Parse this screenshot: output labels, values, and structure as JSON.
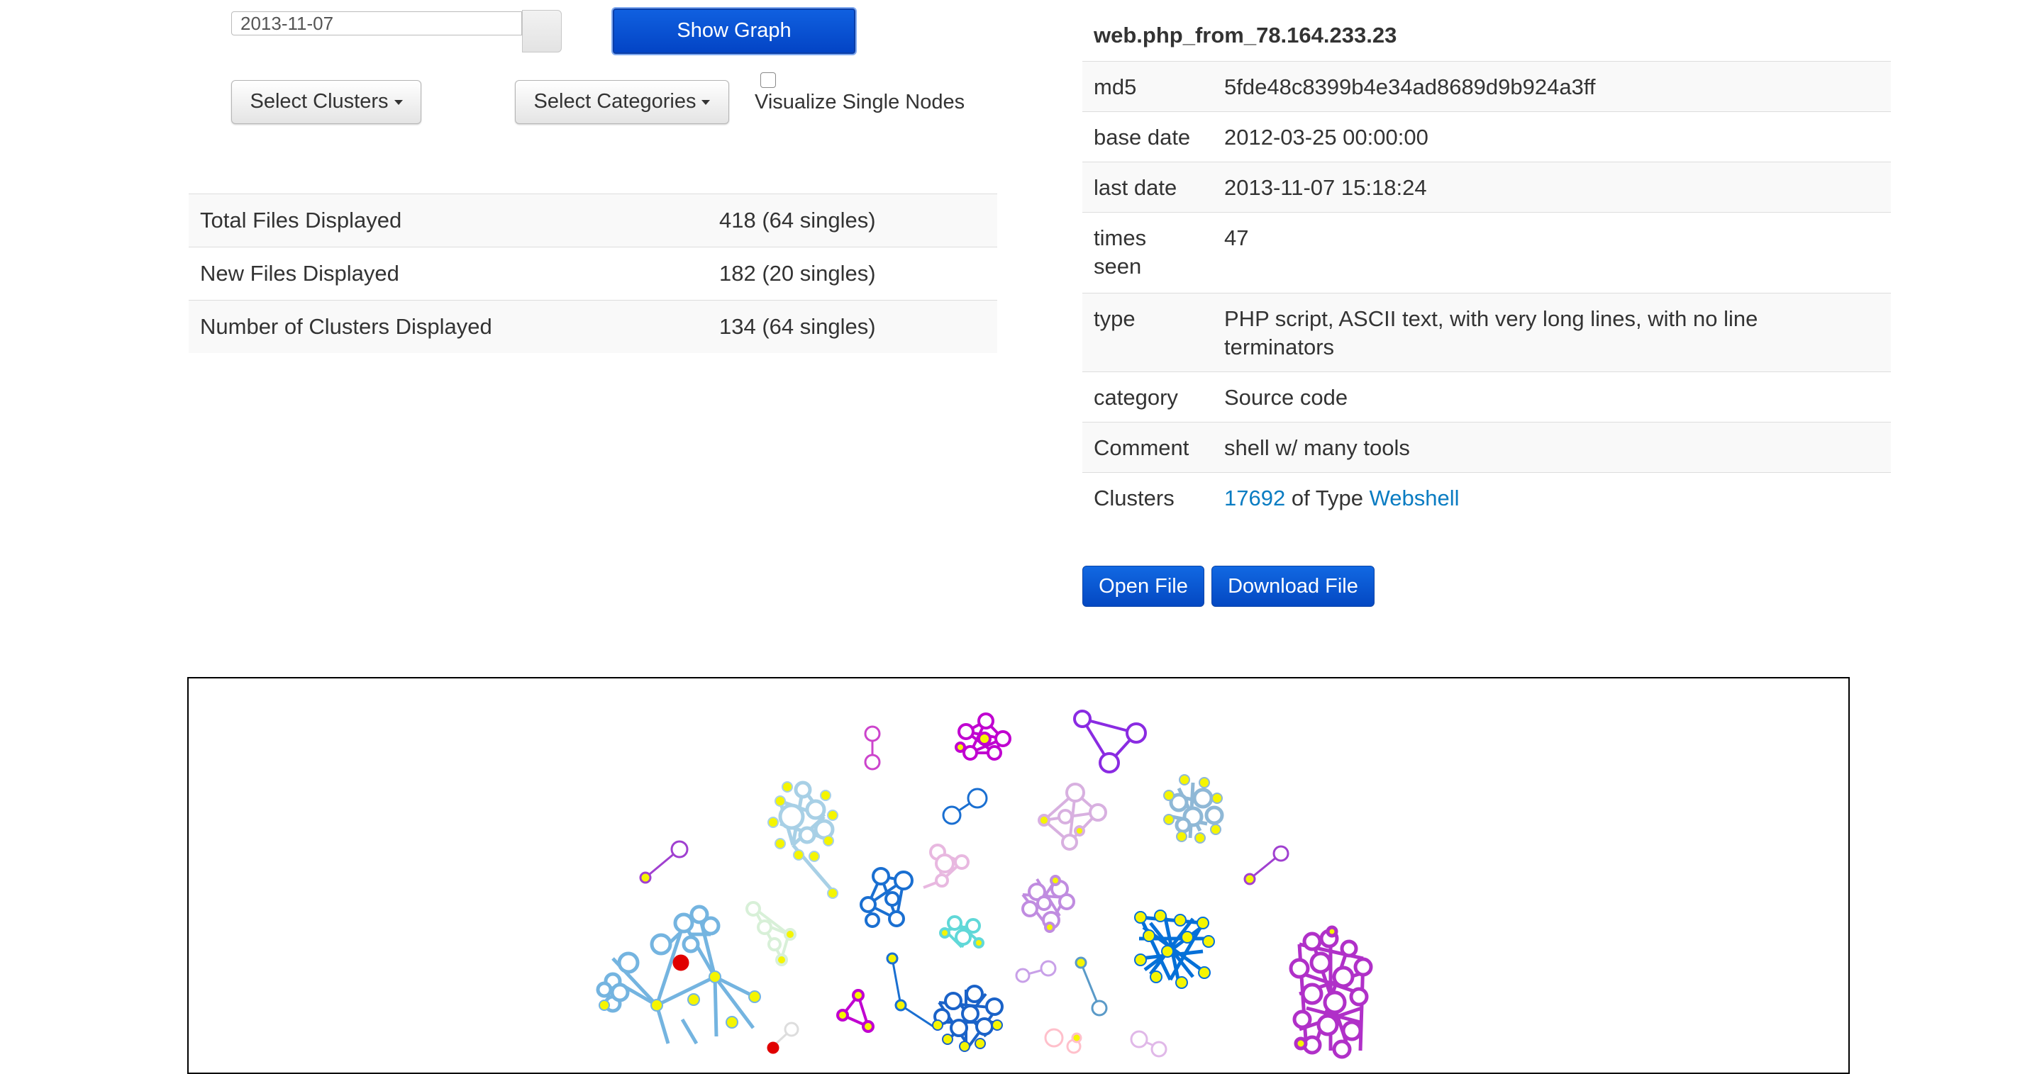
{
  "controls": {
    "date_value": "2013-11-07",
    "show_graph_label": "Show Graph",
    "select_clusters_label": "Select Clusters",
    "select_categories_label": "Select Categories",
    "single_nodes_label": "Visualize Single Nodes",
    "single_nodes_checked": false
  },
  "stats": [
    {
      "label": "Total Files Displayed",
      "value": "418 (64 singles)"
    },
    {
      "label": "New Files Displayed",
      "value": "182 (20 singles)"
    },
    {
      "label": "Number of Clusters Displayed",
      "value": "134 (64 singles)"
    }
  ],
  "file_details": {
    "title": "web.php_from_78.164.233.23",
    "rows": [
      {
        "key": "md5",
        "value": "5fde48c8399b4e34ad8689d9b924a3ff"
      },
      {
        "key": "base date",
        "value": "2012-03-25 00:00:00"
      },
      {
        "key": "last date",
        "value": "2013-11-07 15:18:24"
      },
      {
        "key": "times seen",
        "value": "47"
      },
      {
        "key": "type",
        "value": "PHP script, ASCII text, with very long lines, with no line terminators"
      },
      {
        "key": "category",
        "value": "Source code"
      },
      {
        "key": "Comment",
        "value": "shell w/ many tools"
      }
    ],
    "clusters": {
      "key": "Clusters",
      "cluster_id": "17692",
      "of_type_text": " of Type ",
      "type_link": "Webshell"
    },
    "open_file_label": "Open File",
    "download_file_label": "Download File"
  },
  "colors": {
    "primary": "#0448c2",
    "link": "#0a7cc2",
    "node_yellow": "#f5f500",
    "node_red": "#e00000"
  }
}
